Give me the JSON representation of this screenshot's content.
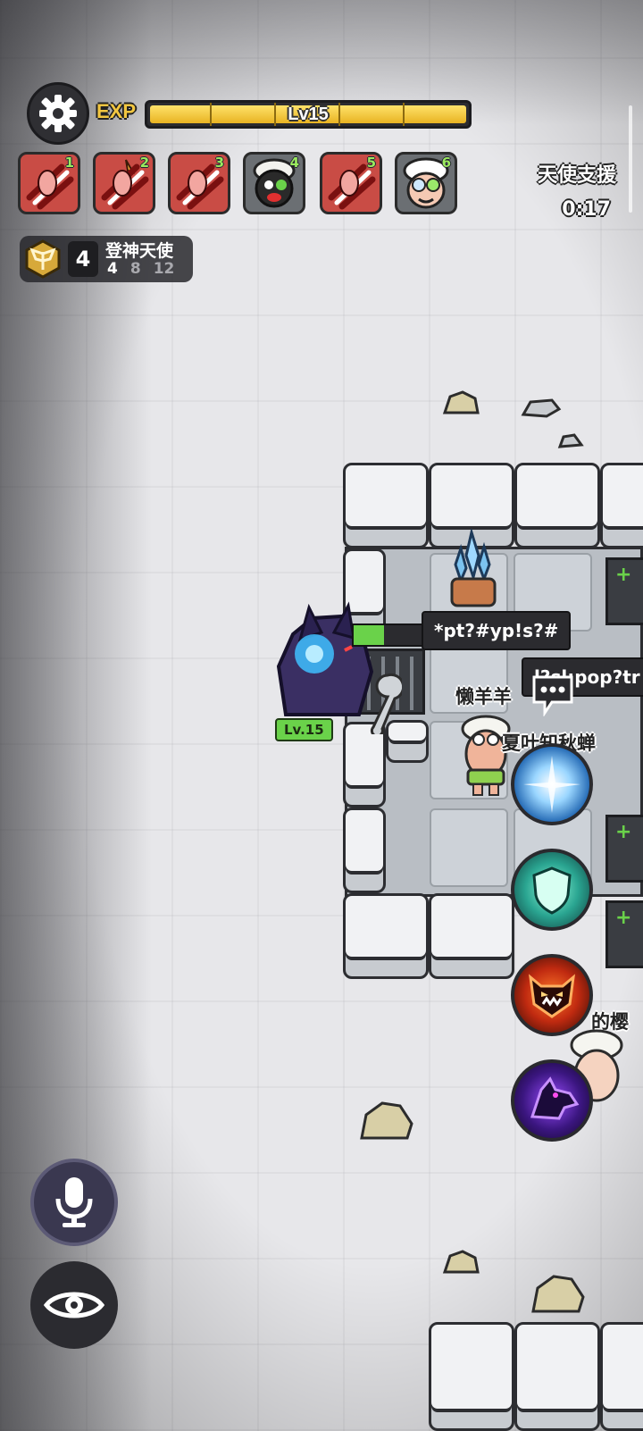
{
  "hud": {
    "exp_label": "EXP",
    "level_text": "Lv15",
    "exp_progress_fraction": 0.999,
    "angel_support": {
      "title": "天使支援",
      "timer": "0:17"
    },
    "skill_slots": [
      {
        "num": "1",
        "icon": "claw-slash-icon",
        "color": "red"
      },
      {
        "num": "2",
        "icon": "flaming-claw-icon",
        "color": "red"
      },
      {
        "num": "3",
        "icon": "claw-slash-icon",
        "color": "red"
      },
      {
        "num": "4",
        "icon": "black-sheep-icon",
        "color": "grey"
      },
      {
        "num": "5",
        "icon": "claw-slash-icon",
        "color": "red"
      },
      {
        "num": "6",
        "icon": "sheep-goggles-icon",
        "color": "grey"
      }
    ],
    "synergy": {
      "count": "4",
      "name": "登神天使",
      "tiers": [
        "4",
        "8",
        "12"
      ],
      "active_tier_index": 0
    }
  },
  "world": {
    "enemy": {
      "level_tag": "Lv.15"
    },
    "player": {
      "name": "懒羊羊"
    },
    "other_player_name_partial": "夏叶知秋蝉",
    "right_edge_name_partial": "的樱",
    "chat_bubbles": [
      {
        "text": "*pt?#yp!s?#"
      },
      {
        "text": "l?sl:pop?tr"
      }
    ]
  },
  "actions": {
    "skills": [
      {
        "icon": "light-burst-icon"
      },
      {
        "icon": "shield-icon"
      },
      {
        "icon": "demon-mask-icon"
      },
      {
        "icon": "wolf-howl-icon"
      }
    ],
    "mic_icon": "microphone-icon",
    "eye_icon": "eye-icon",
    "chat_icon": "chat-bubble-icon"
  },
  "colors": {
    "exp_fill": "#f0c83a",
    "slot_red": "#c94c45",
    "slot_grey": "#6b6f73",
    "hp_green": "#6ad24a"
  }
}
